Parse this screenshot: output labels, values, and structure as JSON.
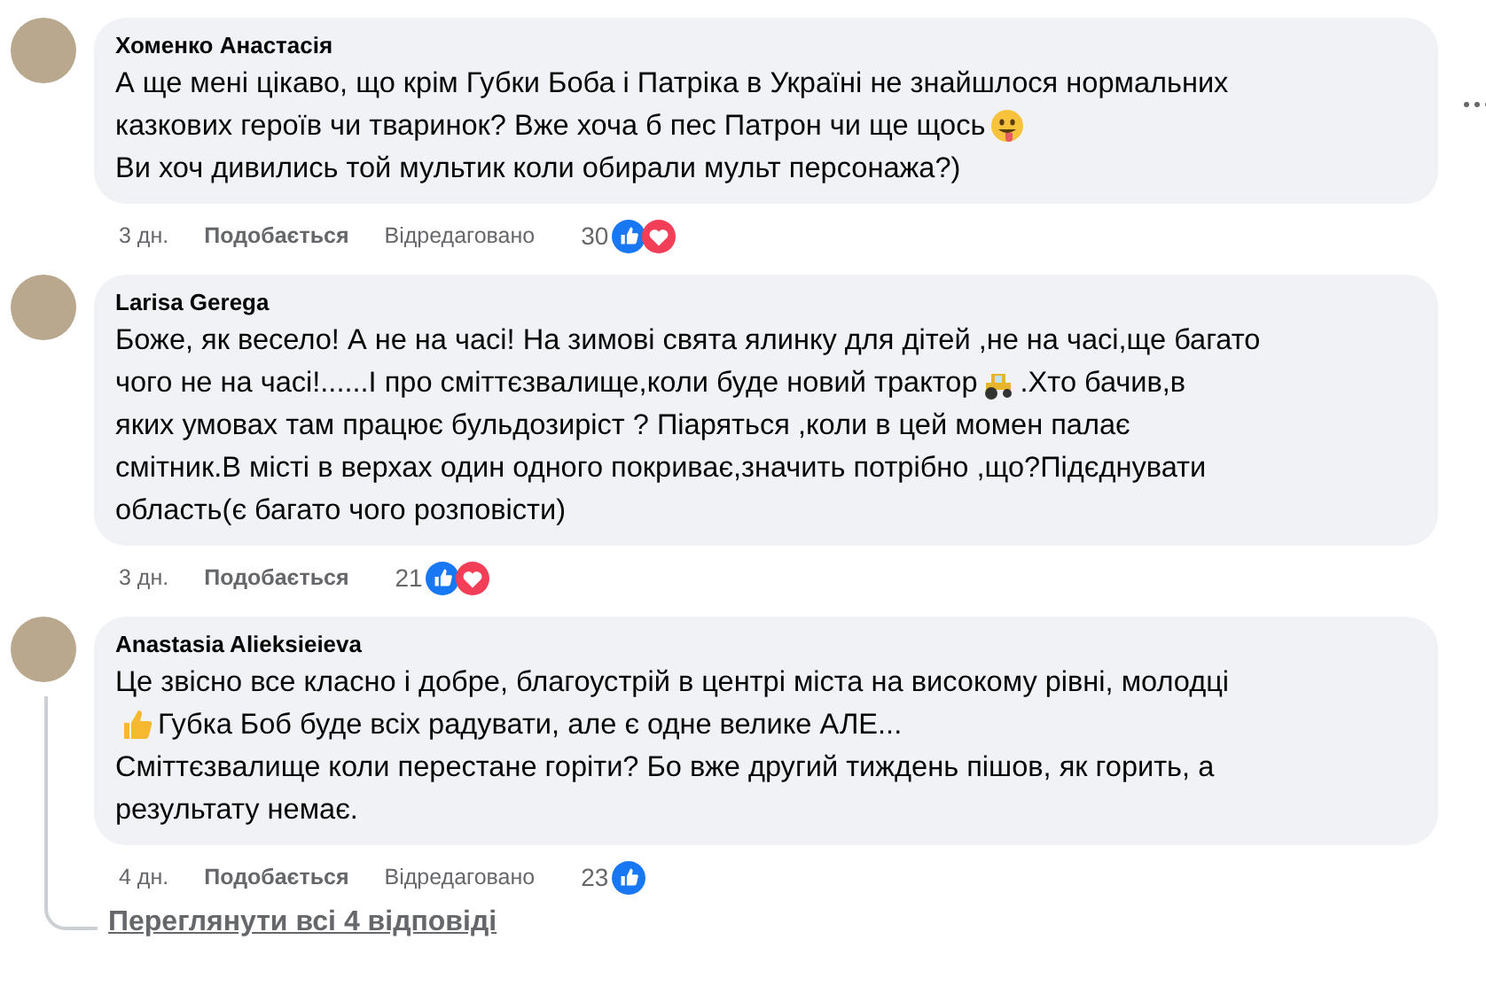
{
  "comments": [
    {
      "author": "Хоменко Анастасія",
      "lines": [
        [
          {
            "kind": "text",
            "text": "А ще мені цікаво, що крім Губки Боба і Патріка в Україні не знайшлося нормальних"
          }
        ],
        [
          {
            "kind": "text",
            "text": "казкових героїв чи тваринок? Вже хоча б пес Патрон чи ще щось"
          },
          {
            "kind": "emoji-grin"
          }
        ],
        [
          {
            "kind": "text",
            "text": "Ви хоч дивились той мультик коли обирали мульт персонажа?)"
          }
        ]
      ],
      "time": "3 дн.",
      "like": "Подобається",
      "edited": "Відредаговано",
      "count": "30",
      "reactions": [
        {
          "kind": "like"
        },
        {
          "kind": "love"
        }
      ]
    },
    {
      "author": "Larisa Gerega",
      "lines": [
        [
          {
            "kind": "text",
            "text": "Боже, як весело! А не на часі! На зимові свята ялинку для дітей ,не на часі,ще багато"
          }
        ],
        [
          {
            "kind": "text",
            "text": "чого не на часі!......І про сміттєзвалище,коли буде новий трактор"
          },
          {
            "kind": "emoji-tractor"
          },
          {
            "kind": "text",
            "text": ".Хто бачив,в"
          }
        ],
        [
          {
            "kind": "text",
            "text": "яких умовах там працює бульдозиріст ? Піаряться ,коли в цей момен палає"
          }
        ],
        [
          {
            "kind": "text",
            "text": "смітник.В місті в верхах один одного покриває,значить потрібно ,що?Підєднувати"
          }
        ],
        [
          {
            "kind": "text",
            "text": "область(є багато чого розповісти)"
          }
        ]
      ],
      "time": "3 дн.",
      "like": "Подобається",
      "count": "21",
      "reactions": [
        {
          "kind": "like"
        },
        {
          "kind": "love"
        }
      ]
    },
    {
      "author": "Anastasia Alieksieieva",
      "lines": [
        [
          {
            "kind": "text",
            "text": "Це звісно все класно і добре, благоустрій в центрі міста на високому рівні, молодці"
          }
        ],
        [
          {
            "kind": "emoji-thumb"
          },
          {
            "kind": "text",
            "text": "Губка Боб буде всіх радувати, але є одне велике АЛЕ..."
          }
        ],
        [
          {
            "kind": "text",
            "text": "Сміттєзвалище коли перестане горіти? Бо вже другий тиждень пішов, як горить, а"
          }
        ],
        [
          {
            "kind": "text",
            "text": "результату немає."
          }
        ]
      ],
      "time": "4 дн.",
      "like": "Подобається",
      "edited": "Відредаговано",
      "count": "23",
      "reactions": [
        {
          "kind": "like"
        }
      ]
    }
  ],
  "replies_link": "Переглянути всі 4 відповіді"
}
